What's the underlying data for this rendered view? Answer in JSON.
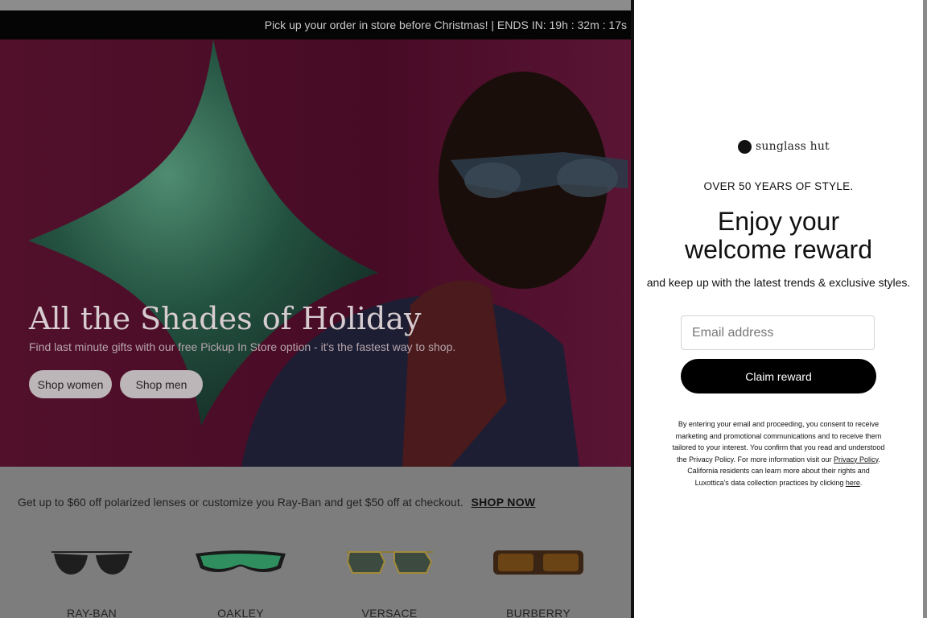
{
  "promo_bar": {
    "text": "Pick up your order in store before Christmas! | ENDS IN: 19h : 32m : 17s"
  },
  "hero": {
    "title": "All the Shades of Holiday",
    "subtitle": "Find last minute gifts with our free Pickup In Store option - it's the fastest way to shop.",
    "buttons": [
      {
        "label": "Shop women"
      },
      {
        "label": "Shop men"
      }
    ]
  },
  "offer": {
    "text": "Get up to $60 off polarized lenses or customize you Ray-Ban and get $50 off at checkout.",
    "link": "SHOP NOW"
  },
  "brands": [
    {
      "label": "RAY-BAN"
    },
    {
      "label": "OAKLEY"
    },
    {
      "label": "VERSACE"
    },
    {
      "label": "BURBERRY"
    }
  ],
  "modal": {
    "logo_text": "sunglass hut",
    "kicker": "OVER 50 YEARS OF STYLE.",
    "headline_line1": "Enjoy your",
    "headline_line2": "welcome reward",
    "subtext": "and keep up with the latest trends & exclusive styles.",
    "email_placeholder": "Email address",
    "claim_button": "Claim reward",
    "legal_part1": "By entering your email and proceeding, you consent to receive marketing and promotional communications and to receive them tailored to your interest. You confirm that you read and understood the Privacy Policy. For more information visit our",
    "legal_link1": "Privacy Policy",
    "legal_part2": ". California residents can learn more about their rights and Luxottica's data collection practices by clicking",
    "legal_link2": "here",
    "legal_end": "."
  },
  "colors": {
    "hero_bg": "#4a0b24",
    "promo_bar_bg": "#050505",
    "claim_button_bg": "#000000",
    "accent_green": "#1f6a4d"
  }
}
